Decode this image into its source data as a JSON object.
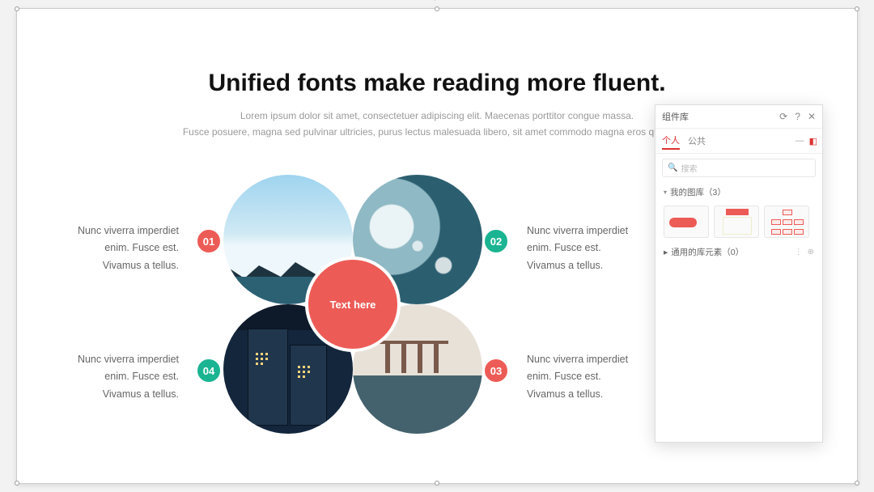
{
  "title": "Unified fonts make reading more fluent.",
  "subtitle1": "Lorem ipsum dolor sit amet, consectetuer adipiscing elit. Maecenas porttitor congue massa.",
  "subtitle2": "Fusce posuere, magna sed pulvinar ultricies, purus lectus malesuada libero, sit amet commodo magna eros quis urna.",
  "center_label": "Text here",
  "badges": {
    "b1": "01",
    "b2": "02",
    "b3": "03",
    "b4": "04"
  },
  "blocks": {
    "l1": "Nunc viverra imperdiet",
    "l2": "enim. Fusce est.",
    "l3": "Vivamus a tellus."
  },
  "panel": {
    "title": "组件库",
    "tabs": {
      "personal": "个人",
      "public": "公共"
    },
    "search_placeholder": "搜索",
    "section_personal": "我的图库（3）",
    "section_system": "通用的库元素（0）"
  }
}
